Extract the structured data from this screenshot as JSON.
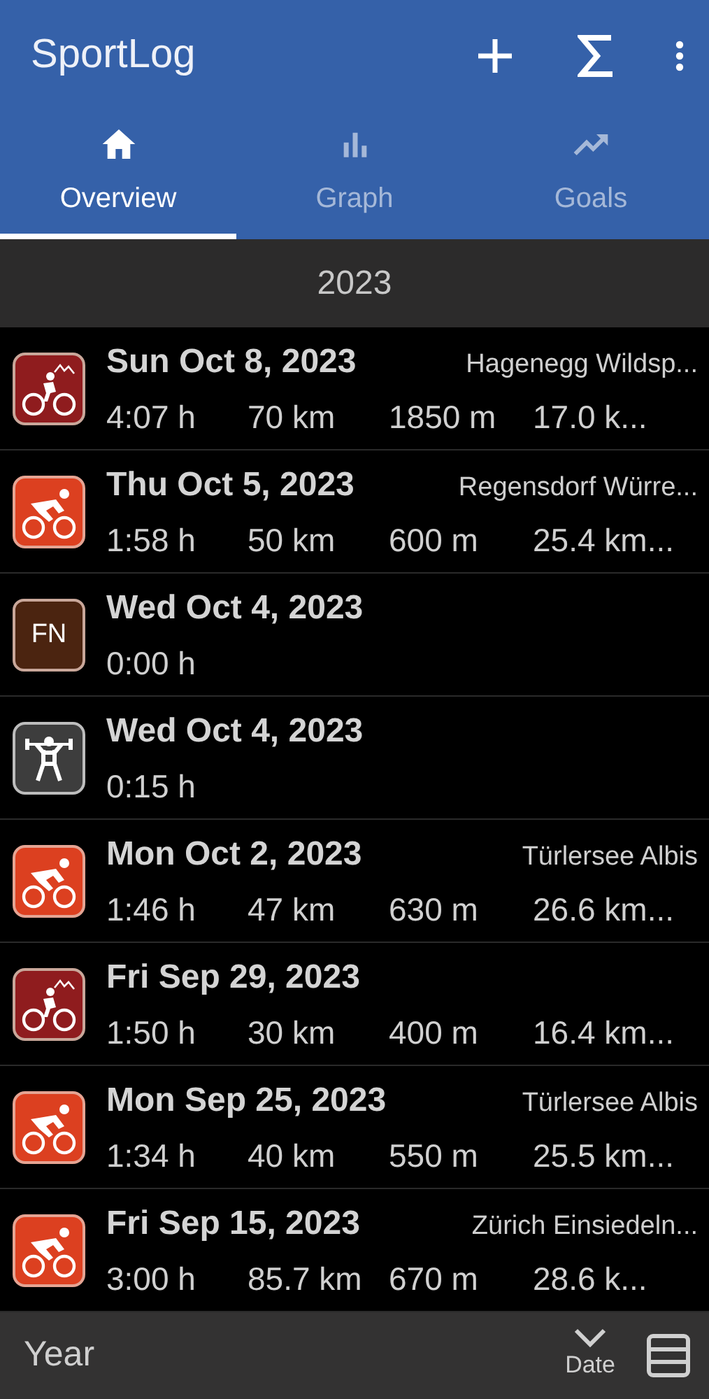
{
  "app_bar": {
    "title": "SportLog"
  },
  "tabs": [
    {
      "label": "Overview",
      "kind": "home",
      "selected": true
    },
    {
      "label": "Graph",
      "kind": "bars",
      "selected": false
    },
    {
      "label": "Goals",
      "kind": "trend",
      "selected": false
    }
  ],
  "section_header": "2023",
  "activities": [
    {
      "kind": "mtb",
      "date": "Sun Oct 8, 2023",
      "location": "Hagenegg Wildsp...",
      "stats": [
        "4:07 h",
        "70 km",
        "1850 m",
        "17.0 k..."
      ]
    },
    {
      "kind": "road",
      "date": "Thu Oct 5, 2023",
      "location": "Regensdorf Würre...",
      "stats": [
        "1:58 h",
        "50 km",
        "600 m",
        "25.4 km..."
      ]
    },
    {
      "kind": "badge",
      "badge": "FN",
      "date": "Wed Oct 4, 2023",
      "stats": [
        "0:00 h"
      ]
    },
    {
      "kind": "strength",
      "date": "Wed Oct 4, 2023",
      "stats": [
        "0:15 h"
      ]
    },
    {
      "kind": "road",
      "date": "Mon Oct 2, 2023",
      "location": "Türlersee Albis",
      "stats": [
        "1:46 h",
        "47 km",
        "630 m",
        "26.6 km..."
      ]
    },
    {
      "kind": "mtb",
      "date": "Fri Sep 29, 2023",
      "stats": [
        "1:50 h",
        "30 km",
        "400 m",
        "16.4 km..."
      ]
    },
    {
      "kind": "road",
      "date": "Mon Sep 25, 2023",
      "location": "Türlersee Albis",
      "stats": [
        "1:34 h",
        "40 km",
        "550 m",
        "25.5 km..."
      ]
    },
    {
      "kind": "road",
      "date": "Fri Sep 15, 2023",
      "location": "Zürich Einsiedeln...",
      "stats": [
        "3:00 h",
        "85.7 km",
        "670 m",
        "28.6 k..."
      ]
    }
  ],
  "bottom_bar": {
    "group_by": "Year",
    "sort_label": "Date"
  }
}
